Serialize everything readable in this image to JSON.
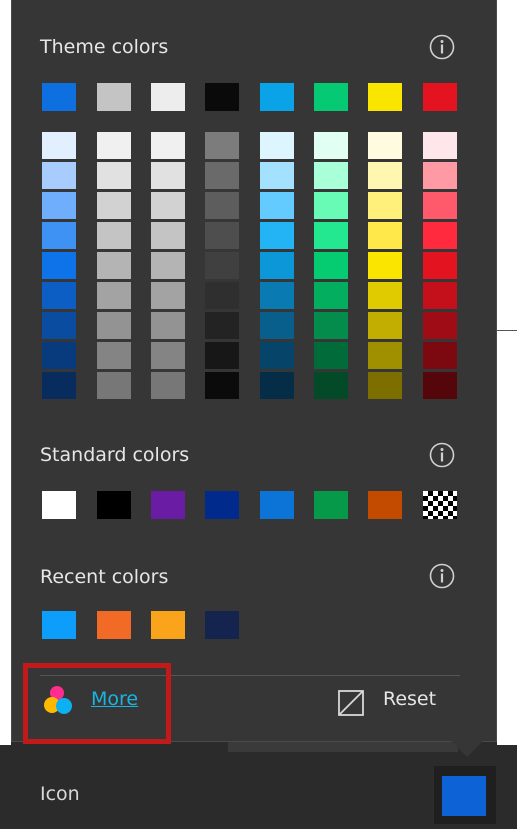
{
  "theme": {
    "title": "Theme colors",
    "header": [
      "#0e6fe0",
      "#c4c4c4",
      "#ededed",
      "#0a0a0a",
      "#0aa3e8",
      "#05ca73",
      "#fae500",
      "#e3131f"
    ],
    "columns": [
      [
        "#e2efff",
        "#a9ccff",
        "#6faefc",
        "#3d92f4",
        "#0e72e8",
        "#0c5ec4",
        "#0a4c9f",
        "#083b7e",
        "#072c5d"
      ],
      [
        "#f0f0f0",
        "#e1e1e1",
        "#d2d2d2",
        "#c4c4c4",
        "#b4b4b4",
        "#a3a3a3",
        "#939393",
        "#848484",
        "#777777"
      ],
      [
        "#f0f0f0",
        "#e1e1e1",
        "#d2d2d2",
        "#c4c4c4",
        "#b4b4b4",
        "#a3a3a3",
        "#939393",
        "#848484",
        "#777777"
      ],
      [
        "#7c7c7c",
        "#6a6a6a",
        "#5d5d5d",
        "#4e4e4e",
        "#404040",
        "#2f2f2f",
        "#232323",
        "#171717",
        "#0b0b0b"
      ],
      [
        "#ddf5ff",
        "#a3e1ff",
        "#63cbff",
        "#23b4f5",
        "#0c98d8",
        "#0a7bb2",
        "#085f8c",
        "#064469",
        "#052d47"
      ],
      [
        "#e1fff2",
        "#a9ffd8",
        "#67fbb5",
        "#24e88f",
        "#05cc71",
        "#04ae5f",
        "#038c4c",
        "#026b3a",
        "#024a28"
      ],
      [
        "#fffbe0",
        "#fff6b0",
        "#fff07b",
        "#ffe84a",
        "#fae500",
        "#e0cb00",
        "#c1ae00",
        "#a09000",
        "#7c6f00"
      ],
      [
        "#ffe6ea",
        "#ff99a3",
        "#ff5a6b",
        "#ff2a3e",
        "#e3131f",
        "#c4101a",
        "#a00c15",
        "#7c0910",
        "#55060a"
      ]
    ]
  },
  "standard": {
    "title": "Standard colors",
    "swatches": [
      "#ffffff",
      "#000000",
      "#6a1ca5",
      "#002b8c",
      "#0b74d6",
      "#07994a",
      "#c24b00",
      "transparent"
    ]
  },
  "recent": {
    "title": "Recent colors",
    "swatches": [
      "#0d9dfa",
      "#f26b26",
      "#f9a41b",
      "#15234f"
    ]
  },
  "footer": {
    "more_label": "More",
    "reset_label": "Reset"
  },
  "field": {
    "label": "Icon",
    "current_color": "#0d62d6"
  }
}
